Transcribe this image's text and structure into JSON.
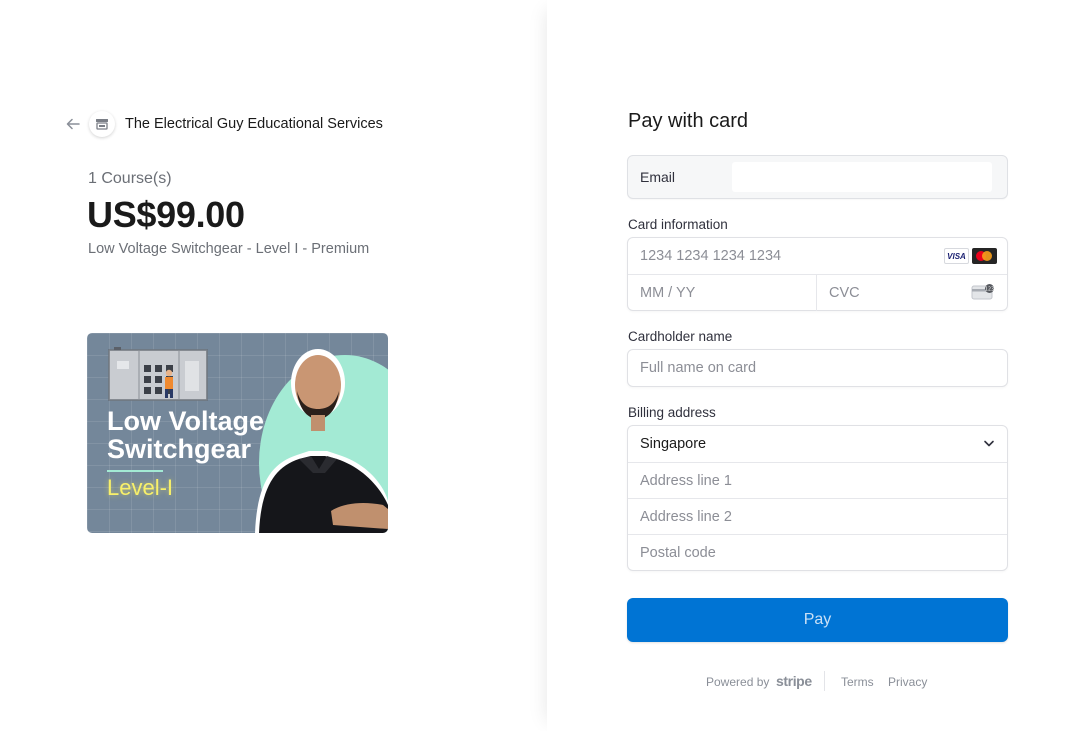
{
  "merchant": {
    "name": "The Electrical Guy Educational Services"
  },
  "summary": {
    "quantity_label": "1 Course(s)",
    "price": "US$99.00",
    "product_name": "Low Voltage Switchgear - Level I - Premium"
  },
  "product_image": {
    "title_line1": "Low Voltage",
    "title_line2": "Switchgear",
    "level": "Level-I"
  },
  "payment": {
    "heading": "Pay with card",
    "email_label": "Email",
    "email_value": "",
    "card_info_label": "Card information",
    "card_number_placeholder": "1234 1234 1234 1234",
    "card_brands": [
      "VISA",
      "mastercard"
    ],
    "visa_text": "VISA",
    "expiry_placeholder": "MM / YY",
    "cvc_placeholder": "CVC",
    "cardholder_label": "Cardholder name",
    "cardholder_placeholder": "Full name on card",
    "billing_label": "Billing address",
    "country_value": "Singapore",
    "address1_placeholder": "Address line 1",
    "address2_placeholder": "Address line 2",
    "postal_placeholder": "Postal code",
    "pay_button": "Pay"
  },
  "footer": {
    "powered_by": "Powered by",
    "stripe": "stripe",
    "terms": "Terms",
    "privacy": "Privacy"
  },
  "colors": {
    "accent": "#0074d4",
    "image_bg": "#74879a",
    "image_blob": "#a3ead4",
    "level_text": "#f8f06a"
  }
}
